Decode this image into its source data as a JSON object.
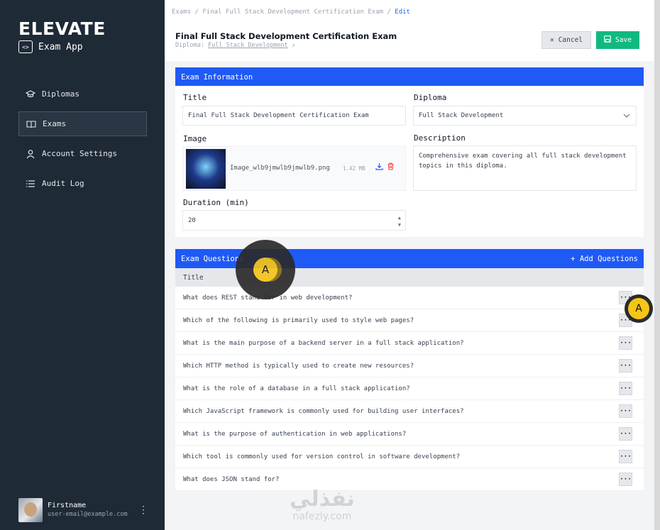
{
  "sidebar": {
    "logo": "ELEVATE",
    "app_title": "Exam App",
    "nav": [
      {
        "label": "Diplomas",
        "icon": "graduation-cap-icon"
      },
      {
        "label": "Exams",
        "icon": "book-open-icon"
      },
      {
        "label": "Account Settings",
        "icon": "user-icon"
      },
      {
        "label": "Audit Log",
        "icon": "list-icon"
      }
    ],
    "active_index": 1,
    "user": {
      "name": "Firstname",
      "email": "user-email@example.com"
    }
  },
  "header": {
    "breadcrumb": [
      "Exams",
      "Final Full Stack Development Certification Exam",
      "Edit"
    ],
    "title": "Final Full Stack Development Certification Exam",
    "diploma_prefix": "Diploma:",
    "diploma_link": "Full Stack Development",
    "cancel_label": "Cancel",
    "save_label": "Save"
  },
  "exam_info": {
    "section_title": "Exam Information",
    "title_label": "Title",
    "title_value": "Final Full Stack Development Certification Exam",
    "diploma_label": "Diploma",
    "diploma_value": "Full Stack Development",
    "image_label": "Image",
    "image_name": "Image_wlb9jmwlb9jmwlb9.png",
    "image_size": "1.42 MB",
    "description_label": "Description",
    "description_value": "Comprehensive exam covering all full stack development topics in this diploma.",
    "duration_label": "Duration (min)",
    "duration_value": "20"
  },
  "questions": {
    "section_title": "Exam Questions",
    "add_label": "+ Add Questions",
    "column_title": "Title",
    "rows": [
      "What does REST stand for in web development?",
      "Which of the following is primarily used to style web pages?",
      "What is the main purpose of a backend server in a full stack application?",
      "Which HTTP method is typically used to create new resources?",
      "What is the role of a database in a full stack application?",
      "Which JavaScript framework is commonly used for building user interfaces?",
      "What is the purpose of authentication in web applications?",
      "Which tool is commonly used for version control in software development?",
      "What does JSON stand for?"
    ],
    "more_label": "···"
  },
  "overlay": {
    "marker_label": "A",
    "watermark_ar": "نفذلي",
    "watermark_en": "nafezly.com"
  },
  "colors": {
    "sidebar": "#1f2a37",
    "accent": "#1f5af6",
    "save": "#10b981",
    "marker": "#f5c518"
  }
}
